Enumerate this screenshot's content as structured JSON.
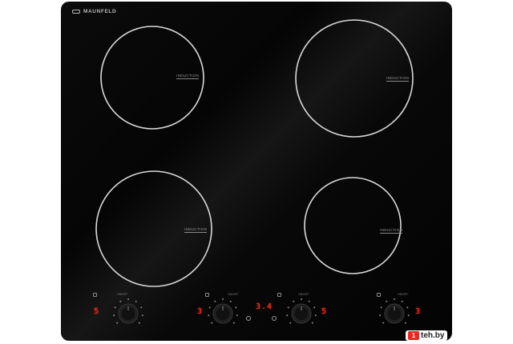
{
  "brand": {
    "name": "MAUNFELD"
  },
  "zones": [
    {
      "label": "INDUCTION"
    },
    {
      "label": "INDUCTION"
    },
    {
      "label": "INDUCTION"
    },
    {
      "label": "INDUCTION"
    }
  ],
  "controls": [
    {
      "label": "ON/OFF",
      "level": "5"
    },
    {
      "label": "ON/OFF",
      "level": "3"
    },
    {
      "label": "ON/OFF",
      "level": "5"
    },
    {
      "label": "ON/OFF",
      "level": "3"
    }
  ],
  "timer": {
    "display": "3.4"
  },
  "watermark": {
    "badge": "1",
    "text": "teh.by"
  },
  "colors": {
    "glass": "#050505",
    "ring": "#d9d9d9",
    "led": "#ff2a1a",
    "watermark_red": "#e52a1f"
  }
}
